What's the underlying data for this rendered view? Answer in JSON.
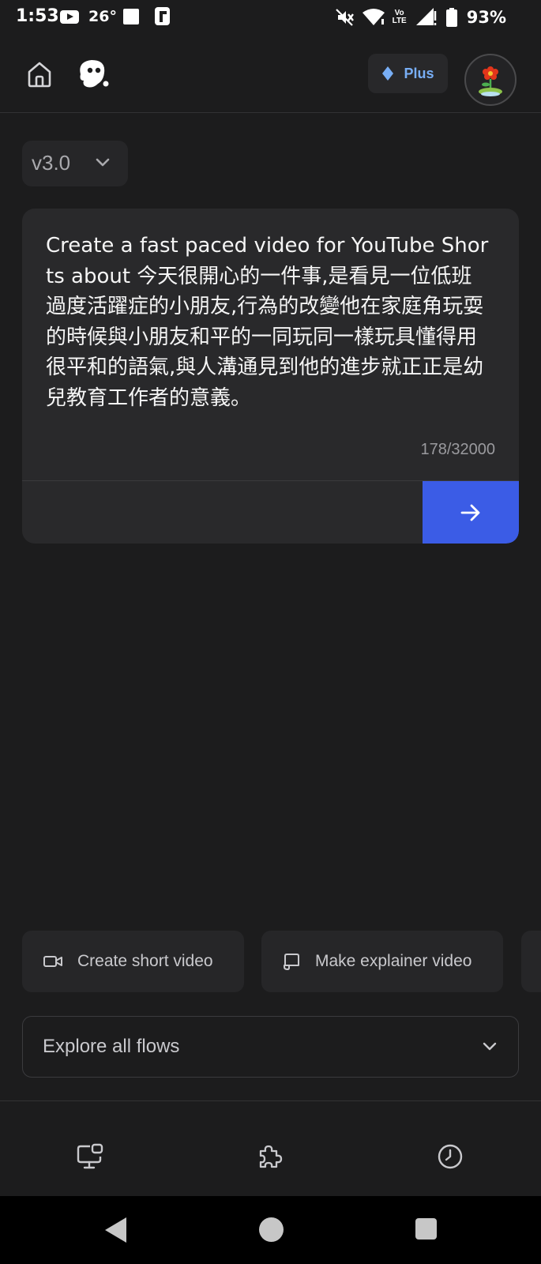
{
  "status_bar": {
    "time": "1:53",
    "temperature": "26°",
    "network": "LTE",
    "battery": "93%"
  },
  "header": {
    "plus_label": "Plus",
    "accent": "#3b5ce6",
    "plus_color": "#78aef5"
  },
  "version": {
    "label": "v3.0"
  },
  "prompt": {
    "text": "Create a fast paced video for YouTube Shorts about 今天很開心的一件事,是看見一位低班過度活躍症的小朋友,行為的改變他在家庭角玩耍的時候與小朋友和平的一同玩同一樣玩具懂得用很平和的語氣,與人溝通見到他的進步就正正是幼兒教育工作者的意義。",
    "char_count": "178/32000"
  },
  "quick_actions": [
    {
      "label": "Create short video",
      "icon": "video-camera-icon"
    },
    {
      "label": "Make explainer video",
      "icon": "scroll-icon"
    }
  ],
  "explore": {
    "label": "Explore all flows"
  },
  "bottom_tabs": [
    {
      "icon": "monitor-chat-icon"
    },
    {
      "icon": "puzzle-icon"
    },
    {
      "icon": "clock-icon"
    }
  ]
}
